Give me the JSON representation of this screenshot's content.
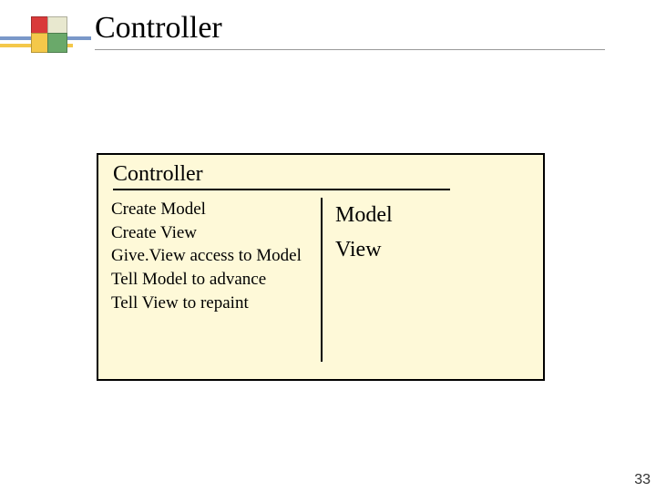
{
  "title": "Controller",
  "panel": {
    "heading": "Controller",
    "left_lines": [
      "Create Model",
      "Create View",
      "Give.View access to Model",
      "Tell Model to advance",
      "Tell View to repaint"
    ],
    "right_lines": [
      "Model",
      "View"
    ]
  },
  "page_number": "33",
  "icon": {
    "name": "four-square-logo",
    "colors": {
      "tl": "#d93a3a",
      "tr": "#e8e8cf",
      "bl": "#f4c84a",
      "br": "#6aa96a"
    }
  }
}
